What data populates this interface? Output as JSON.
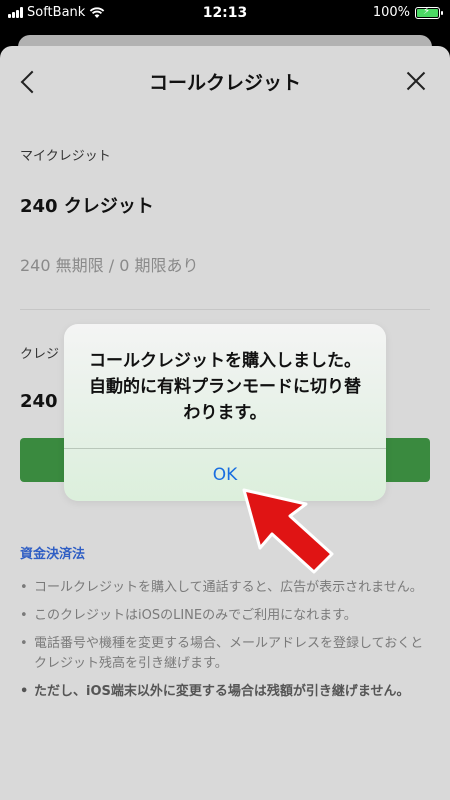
{
  "statusbar": {
    "carrier": "SoftBank",
    "time": "12:13",
    "battery": "100%"
  },
  "header": {
    "title": "コールクレジット"
  },
  "credits": {
    "label": "マイクレジット",
    "amount": "240 クレジット",
    "breakdown": "240 無期限 / 0 期限あり"
  },
  "purchase": {
    "label_partial": "クレジ",
    "amount_partial": "240"
  },
  "footer": {
    "link": "資金決済法",
    "notes": [
      "コールクレジットを購入して通話すると、広告が表示されません。",
      "このクレジットはiOSのLINEのみでご利用になれます。",
      "電話番号や機種を変更する場合、メールアドレスを登録しておくとクレジット残高を引き継げます。",
      "ただし、iOS端末以外に変更する場合は残額が引き継げません。"
    ]
  },
  "dialog": {
    "message": "コールクレジットを購入しました。自動的に有料プランモードに切り替わります。",
    "ok": "OK"
  },
  "colors": {
    "accent_green": "#3a8a3f",
    "link_blue": "#2f5ec4",
    "ok_blue": "#1a6fe0",
    "arrow_red": "#e01414"
  },
  "icons": {
    "back": "chevron-left-icon",
    "close": "close-icon",
    "wifi": "wifi-icon",
    "battery": "battery-charging-icon",
    "pointer": "red-arrow-icon"
  }
}
